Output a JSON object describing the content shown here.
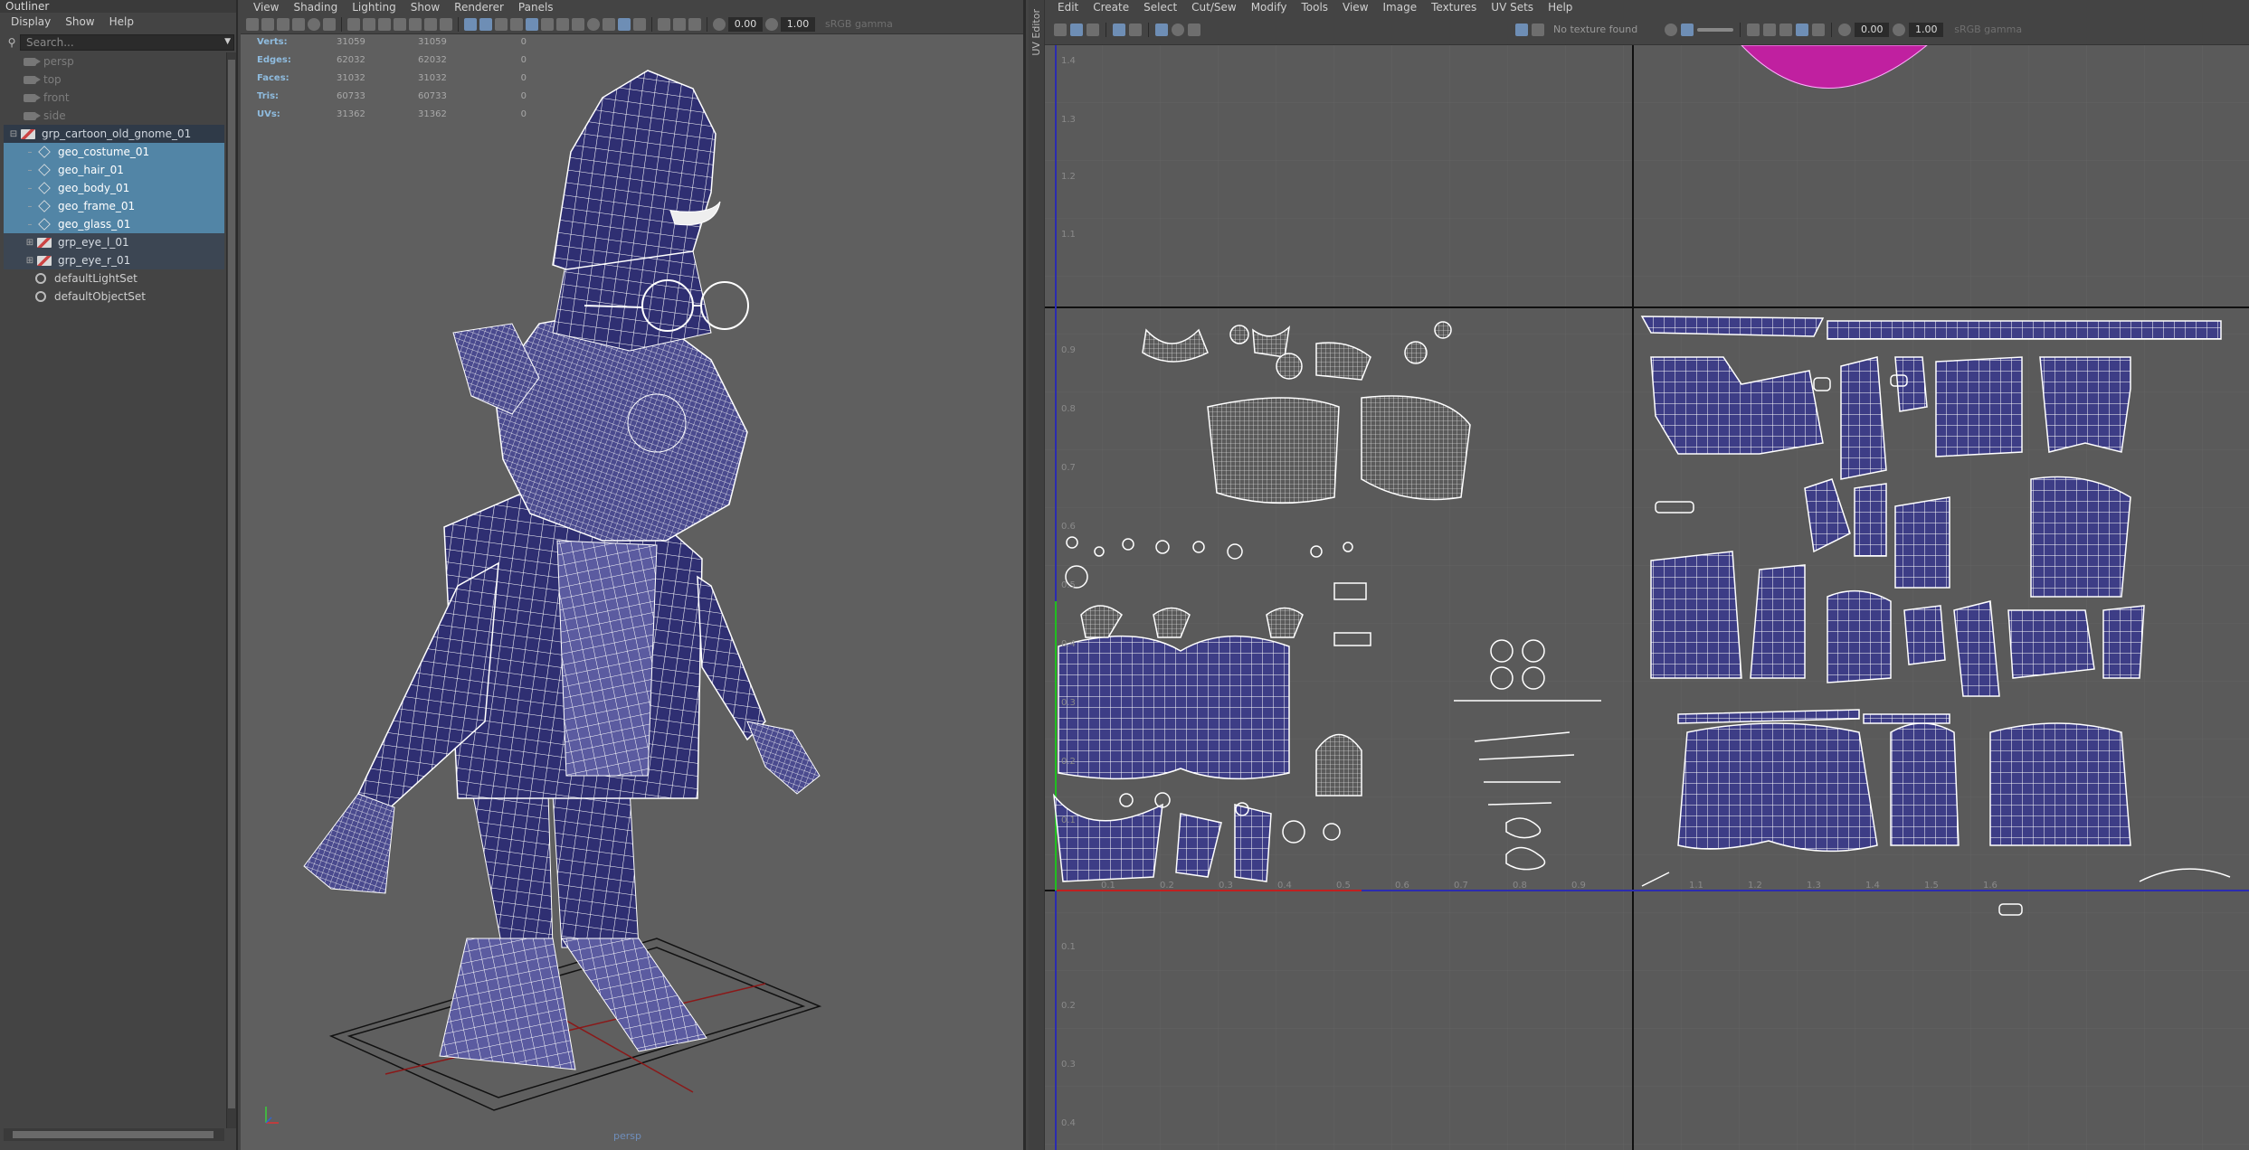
{
  "outliner": {
    "title": "Outliner",
    "menu": [
      "Display",
      "Show",
      "Help"
    ],
    "search_placeholder": "Search...",
    "items": [
      {
        "label": "persp",
        "kind": "camera",
        "state": "dim"
      },
      {
        "label": "top",
        "kind": "camera",
        "state": "dim"
      },
      {
        "label": "front",
        "kind": "camera",
        "state": "dim"
      },
      {
        "label": "side",
        "kind": "camera",
        "state": "dim"
      },
      {
        "label": "grp_cartoon_old_gnome_01",
        "kind": "group",
        "state": "group"
      },
      {
        "label": "geo_costume_01",
        "kind": "mesh",
        "state": "selected"
      },
      {
        "label": "geo_hair_01",
        "kind": "mesh",
        "state": "selected"
      },
      {
        "label": "geo_body_01",
        "kind": "mesh",
        "state": "selected"
      },
      {
        "label": "geo_frame_01",
        "kind": "mesh",
        "state": "selected"
      },
      {
        "label": "geo_glass_01",
        "kind": "mesh",
        "state": "selected"
      },
      {
        "label": "grp_eye_l_01",
        "kind": "group",
        "state": "subgroup"
      },
      {
        "label": "grp_eye_r_01",
        "kind": "group",
        "state": "subgroup"
      },
      {
        "label": "defaultLightSet",
        "kind": "set",
        "state": "normal"
      },
      {
        "label": "defaultObjectSet",
        "kind": "set",
        "state": "normal"
      }
    ]
  },
  "viewport": {
    "menu": [
      "View",
      "Shading",
      "Lighting",
      "Show",
      "Renderer",
      "Panels"
    ],
    "toolbar": {
      "exposure": "0.00",
      "gamma": "1.00",
      "color_space": "sRGB gamma"
    },
    "hud": [
      {
        "key": "Verts:",
        "a": "31059",
        "b": "31059",
        "c": "0"
      },
      {
        "key": "Edges:",
        "a": "62032",
        "b": "62032",
        "c": "0"
      },
      {
        "key": "Faces:",
        "a": "31032",
        "b": "31032",
        "c": "0"
      },
      {
        "key": "Tris:",
        "a": "60733",
        "b": "60733",
        "c": "0"
      },
      {
        "key": "UVs:",
        "a": "31362",
        "b": "31362",
        "c": "0"
      }
    ],
    "camera_name": "persp",
    "mesh_color": "#2f2f72",
    "wire_color": "#ffffff"
  },
  "uv_editor": {
    "tab_label": "UV Editor",
    "menu": [
      "Edit",
      "Create",
      "Select",
      "Cut/Sew",
      "Modify",
      "Tools",
      "View",
      "Image",
      "Textures",
      "UV Sets",
      "Help"
    ],
    "texture_status": "No texture found",
    "exposure": "0.00",
    "gamma": "1.00",
    "color_space": "sRGB gamma",
    "v_ticks": [
      "1.4",
      "1.3",
      "1.2",
      "1.1",
      "0.9",
      "0.8",
      "0.7",
      "0.6",
      "0.5",
      "0.4",
      "0.3",
      "0.2",
      "0.1",
      "0.1",
      "0.2",
      "0.3",
      "0.4"
    ],
    "u_ticks": [
      "0.1",
      "0.2",
      "0.3",
      "0.4",
      "0.5",
      "0.6",
      "0.7",
      "0.8",
      "0.9",
      "1.1",
      "1.2",
      "1.3",
      "1.4",
      "1.5",
      "1.6"
    ],
    "shell_color": "#3d3d86",
    "highlight_color": "#c020a0"
  }
}
